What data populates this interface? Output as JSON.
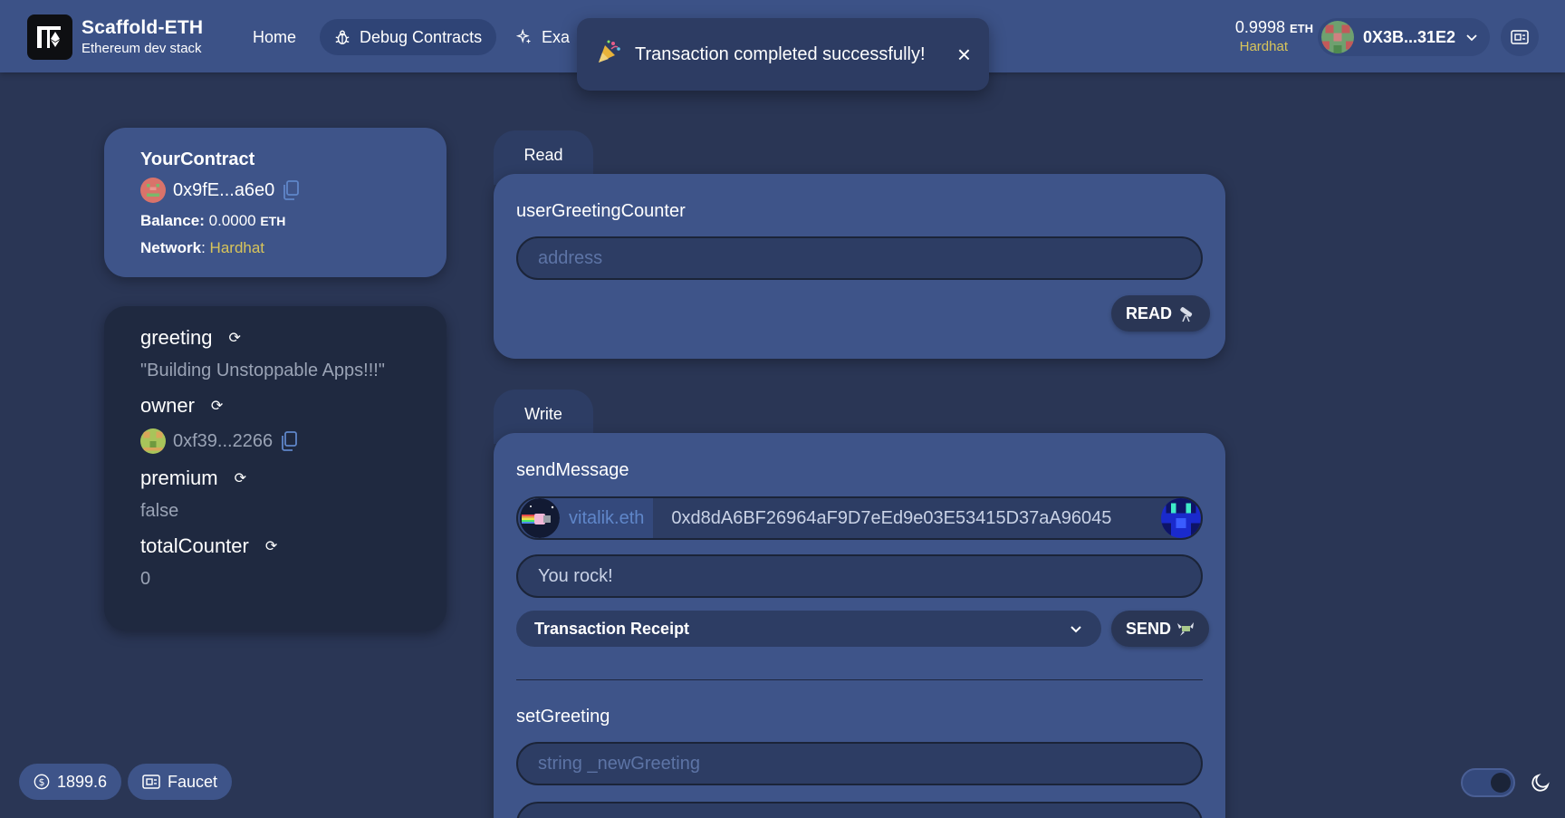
{
  "header": {
    "brand": {
      "title": "Scaffold-ETH",
      "subtitle": "Ethereum dev stack"
    },
    "nav": {
      "home": "Home",
      "debug": "Debug Contracts",
      "example": "Exa"
    },
    "toast": {
      "message": "Transaction completed successfully!",
      "icon": "party-popper-icon"
    },
    "balance": {
      "amount": "0.9998",
      "unit": "ETH",
      "network": "Hardhat"
    },
    "account": {
      "address": "0X3B...31E2"
    }
  },
  "contract": {
    "name": "YourContract",
    "address": "0x9fE...a6e0",
    "balance_label": "Balance:",
    "balance_value": "0.0000",
    "balance_unit": "ETH",
    "network_label": "Network",
    "network_value": "Hardhat"
  },
  "variables": [
    {
      "name": "greeting",
      "value": "\"Building Unstoppable Apps!!!\""
    },
    {
      "name": "owner",
      "value": "0xf39...2266"
    },
    {
      "name": "premium",
      "value": "false"
    },
    {
      "name": "totalCounter",
      "value": "0"
    }
  ],
  "read": {
    "tab": "Read",
    "function": "userGreetingCounter",
    "input_placeholder": "address",
    "button": "READ"
  },
  "write": {
    "tab": "Write",
    "send_message": {
      "function": "sendMessage",
      "ens_name": "vitalik.eth",
      "address": "0xd8dA6BF26964aF9D7eEd9e03E53415D37aA96045",
      "message": "You rock!",
      "receipt_label": "Transaction Receipt",
      "button": "SEND"
    },
    "set_greeting": {
      "function": "setGreeting",
      "input_placeholder": "string _newGreeting"
    }
  },
  "footer": {
    "price": "1899.6",
    "faucet": "Faucet"
  },
  "colors": {
    "background": "#2a3655",
    "header": "#3c5287",
    "card": "#3e5489",
    "dark_card": "#1f2940",
    "accent_yellow": "#d9c55a",
    "link_blue": "#5f86c9"
  }
}
